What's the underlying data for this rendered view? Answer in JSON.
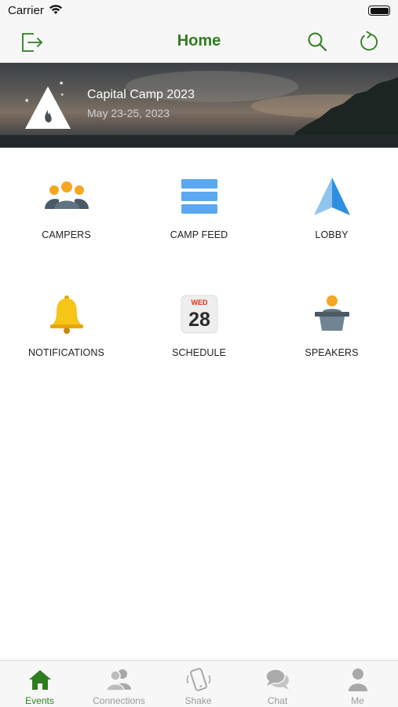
{
  "status_bar": {
    "carrier": "Carrier"
  },
  "nav": {
    "title": "Home"
  },
  "banner": {
    "title": "Capital Camp 2023",
    "dates": "May 23-25, 2023"
  },
  "tiles": [
    {
      "label": "CAMPERS",
      "icon": "campers-icon"
    },
    {
      "label": "CAMP FEED",
      "icon": "camp-feed-icon"
    },
    {
      "label": "LOBBY",
      "icon": "lobby-icon"
    },
    {
      "label": "NOTIFICATIONS",
      "icon": "bell-icon"
    },
    {
      "label": "SCHEDULE",
      "icon": "calendar-icon",
      "calendar": {
        "weekday": "WED",
        "day": "28"
      }
    },
    {
      "label": "SPEAKERS",
      "icon": "speaker-podium-icon"
    }
  ],
  "tab_bar": {
    "tabs": [
      {
        "label": "Events",
        "icon": "home-icon",
        "active": true
      },
      {
        "label": "Connections",
        "icon": "connections-icon",
        "active": false
      },
      {
        "label": "Shake",
        "icon": "shake-phone-icon",
        "active": false
      },
      {
        "label": "Chat",
        "icon": "chat-icon",
        "active": false
      },
      {
        "label": "Me",
        "icon": "person-icon",
        "active": false
      }
    ]
  },
  "colors": {
    "accent": "#2e7d1f",
    "inactive": "#9a9a9a"
  }
}
